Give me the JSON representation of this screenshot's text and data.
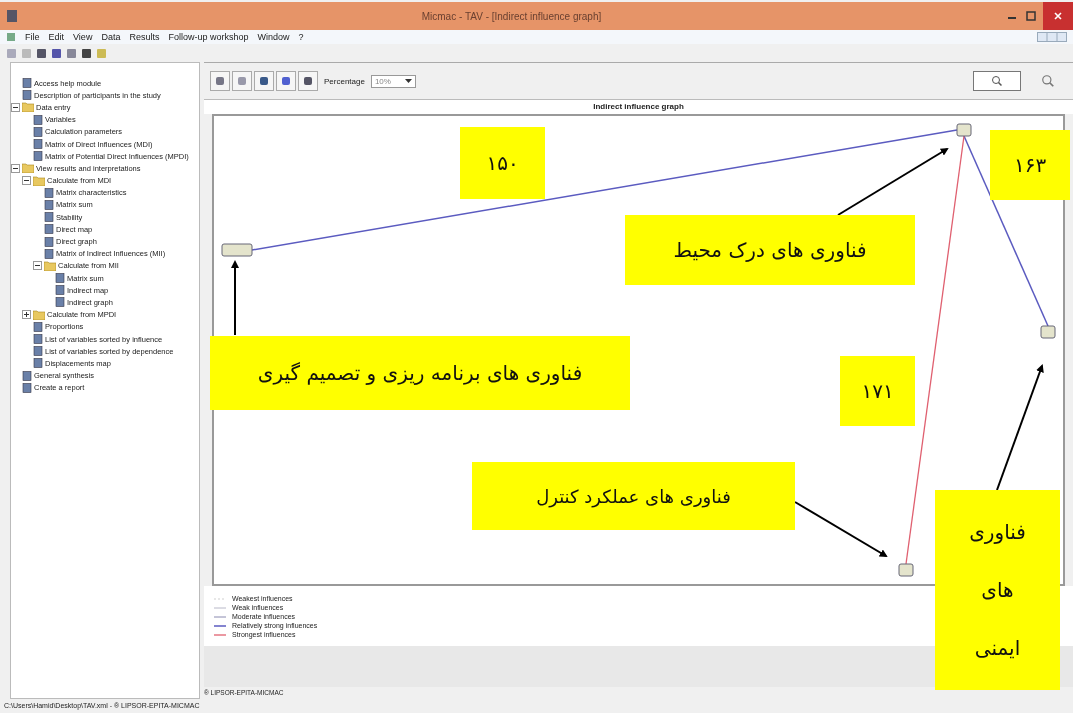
{
  "window": {
    "title": "Micmac - TAV - [Indirect influence graph]"
  },
  "menu": [
    "File",
    "Edit",
    "View",
    "Data",
    "Results",
    "Follow-up workshop",
    "Window",
    "?"
  ],
  "sidebar": {
    "items": [
      {
        "label": "Access help module"
      },
      {
        "label": "Description of participants in the study"
      },
      {
        "label": "Data entry",
        "expanded": true,
        "children": [
          {
            "label": "Variables"
          },
          {
            "label": "Calculation parameters"
          },
          {
            "label": "Matrix of Direct Influences (MDI)"
          },
          {
            "label": "Matrix of Potential Direct Influences (MPDI)"
          }
        ]
      },
      {
        "label": "View results and interpretations",
        "expanded": true,
        "children": [
          {
            "label": "Calculate from MDI",
            "expanded": true,
            "children": [
              {
                "label": "Matrix characteristics"
              },
              {
                "label": "Matrix sum"
              },
              {
                "label": "Stability"
              },
              {
                "label": "Direct map"
              },
              {
                "label": "Direct graph"
              },
              {
                "label": "Matrix of Indirect Influences (MII)"
              },
              {
                "label": "Calculate from MII",
                "expanded": true,
                "children": [
                  {
                    "label": "Matrix sum"
                  },
                  {
                    "label": "Indirect map"
                  },
                  {
                    "label": "Indirect graph"
                  }
                ]
              }
            ]
          },
          {
            "label": "Calculate from MPDI",
            "expanded": false
          },
          {
            "label": "Proportions"
          },
          {
            "label": "List of variables sorted by influence"
          },
          {
            "label": "List of variables sorted by dependence"
          },
          {
            "label": "Displacements map"
          }
        ]
      },
      {
        "label": "General synthesis"
      },
      {
        "label": "Create a report"
      }
    ]
  },
  "toolbar": {
    "percentage_label": "Percentage",
    "percentage_value": "10%"
  },
  "graph": {
    "title": "Indirect influence graph",
    "nodes": [
      {
        "kind": "variable"
      },
      {
        "kind": "variable"
      },
      {
        "kind": "variable"
      },
      {
        "kind": "variable"
      }
    ],
    "edges": [
      {
        "kind": "relatively-strong"
      },
      {
        "kind": "relatively-strong"
      },
      {
        "kind": "strongest"
      }
    ]
  },
  "legend": [
    {
      "label": "Weakest influences",
      "kind": "weakest"
    },
    {
      "label": "Weak influences",
      "kind": "weak"
    },
    {
      "label": "Moderate influences",
      "kind": "moderate"
    },
    {
      "label": "Relatively strong influences",
      "kind": "relatively-strong"
    },
    {
      "label": "Strongest influences",
      "kind": "strongest"
    }
  ],
  "annotations": [
    {
      "text": "۱۵۰"
    },
    {
      "text": "۱۶۳"
    },
    {
      "text": "فناوری های درک محیط"
    },
    {
      "text": "فناوری های برنامه ریزی و تصمیم گیری"
    },
    {
      "text": "۱۷۱"
    },
    {
      "text": "فناوری های عملکرد کنترل"
    },
    {
      "text": "فناوری های ایمنی"
    }
  ],
  "footer": "® LIPSOR-EPITA-MICMAC",
  "status_bar": "C:\\Users\\Hamid\\Desktop\\TAV.xml - ® LIPSOR-EPITA-MICMAC"
}
